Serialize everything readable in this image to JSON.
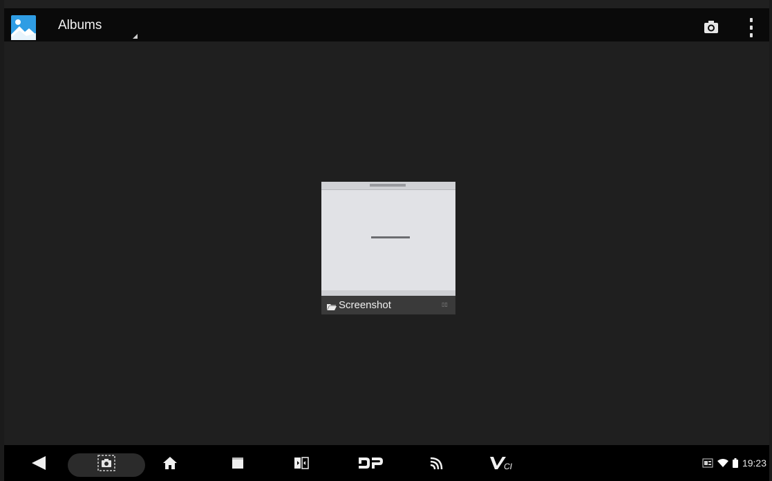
{
  "header": {
    "title": "Albums",
    "app_icon": "gallery-icon",
    "actions": [
      "camera-icon",
      "overflow-menu-icon"
    ]
  },
  "albums": [
    {
      "name": "Screenshot",
      "icon": "folder-icon"
    }
  ],
  "navbar": {
    "items": [
      "back-icon",
      "screenshot-icon",
      "home-icon",
      "recents-icon",
      "dual-window-icon",
      "dp-icon",
      "cast-icon",
      "vci-icon"
    ],
    "vci_label": "Vci",
    "dp_label": "DP"
  },
  "status_bar": {
    "time": "19:23",
    "icons": [
      "notification-icon",
      "wifi-icon",
      "battery-icon"
    ]
  },
  "colors": {
    "background": "#1f1f1f",
    "action_bar": "#0a0a0a",
    "nav_bar": "#000000",
    "app_icon_blue": "#2f9de4"
  }
}
